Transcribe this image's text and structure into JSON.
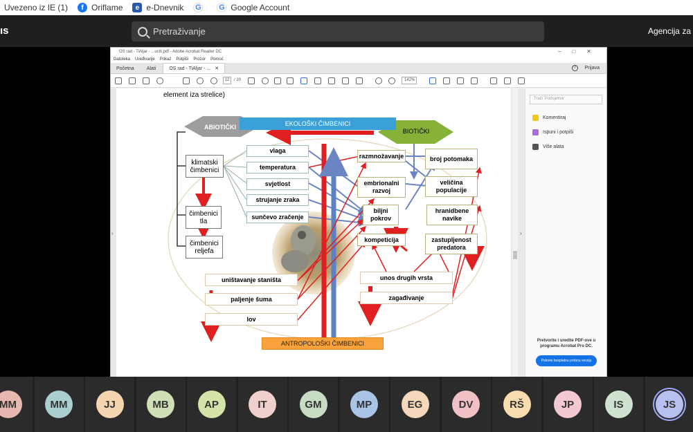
{
  "bookmarks": [
    {
      "label": "Uvezeno iz IE (1)",
      "icon": ""
    },
    {
      "label": "Oriflame",
      "icon": "facebook-icon"
    },
    {
      "label": "e-Dnevnik",
      "icon": "ednevnik-icon"
    },
    {
      "label": "",
      "icon": "google-icon"
    },
    {
      "label": "Google Account",
      "icon": "google-icon"
    }
  ],
  "topbar": {
    "app_name": "ıs",
    "search_placeholder": "Pretraživanje",
    "org": "Agencija za"
  },
  "acrobat": {
    "title": "OS rad - TiAljar - ...uciti.pdf - Adobe Acrobat Reader DC",
    "menu": [
      "Datoteka",
      "Uređivanje",
      "Prikaz",
      "Potpiši",
      "Prozor",
      "Pomoć"
    ],
    "tabs": [
      {
        "label": "Početna"
      },
      {
        "label": "Alati"
      },
      {
        "label": "OS rad - TiAljar - ..."
      }
    ],
    "login": "Prijava",
    "page_current": "12",
    "page_total": "/ 20",
    "zoom": "142%",
    "panel": {
      "search_placeholder": "Traži 'Podsjetnik'",
      "items": [
        "Komentiraj",
        "Ispuni i potpiši",
        "Više alata"
      ],
      "promo": "Pretvorite i uredite PDF-ove u programu Acrobat Pro DC.",
      "promo_button": "Pokreni besplatnu probnu verziju"
    }
  },
  "diagram": {
    "intro": "element iza strelice)",
    "ekoloski": "EKOLOŠKI ČIMBENICI",
    "abioticki": "ABIOTIČKI",
    "bioticki": "BIOTIČKI",
    "antropoloski": "ANTROPOLOŠKI ČIMBENICI",
    "left": [
      "klimatski čimbenici",
      "čimbenici tla",
      "čimbenici reljefa"
    ],
    "abiotic_factors": [
      "vlaga",
      "temperatura",
      "svjetlost",
      "strujanje zraka",
      "sunčevo zračenje"
    ],
    "biotic_mid": [
      "razmnožavanje",
      "embrionalni razvoj",
      "biljni pokrov",
      "kompeticija"
    ],
    "biotic_right": [
      "broj potomaka",
      "veličina populacije",
      "hranidbene navike",
      "zastupljenost predatora"
    ],
    "anthropo_left": [
      "uništavanje staništa",
      "paljenje šuma",
      "lov"
    ],
    "anthropo_right": [
      "unos drugih vrsta",
      "zagađivanje"
    ]
  },
  "participants": [
    {
      "initials": "MM",
      "color": "#e8b8b0"
    },
    {
      "initials": "MM",
      "color": "#a9cfd1"
    },
    {
      "initials": "JJ",
      "color": "#f5d5b0"
    },
    {
      "initials": "MB",
      "color": "#cfe0b6"
    },
    {
      "initials": "AP",
      "color": "#d4e4a8"
    },
    {
      "initials": "IT",
      "color": "#f0d0cc"
    },
    {
      "initials": "GM",
      "color": "#c8dcc4"
    },
    {
      "initials": "MP",
      "color": "#aac4e8"
    },
    {
      "initials": "EG",
      "color": "#f5d8bc"
    },
    {
      "initials": "DV",
      "color": "#f0c0c4"
    },
    {
      "initials": "RŠ",
      "color": "#f8dcb0"
    },
    {
      "initials": "JP",
      "color": "#f4c8d0"
    },
    {
      "initials": "IS",
      "color": "#cfe2cf"
    },
    {
      "initials": "JS",
      "color": "#b8c0f0"
    }
  ]
}
